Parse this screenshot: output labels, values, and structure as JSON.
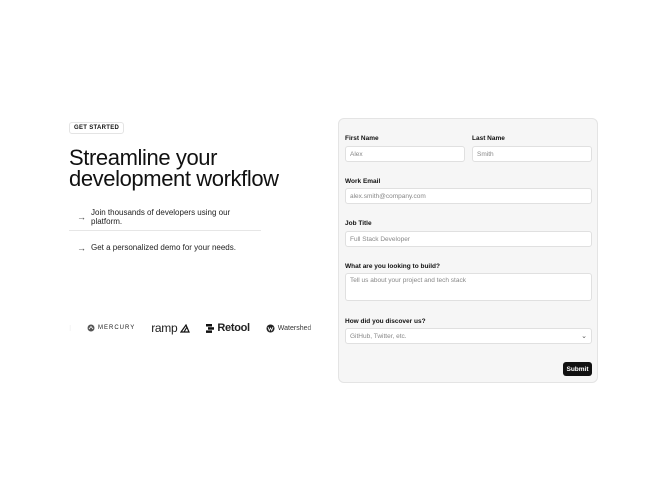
{
  "hero": {
    "badge": "GET STARTED",
    "title_line1": "Streamline your",
    "title_line2": "development workflow",
    "benefits": [
      {
        "icon": "arrow-right-icon",
        "text": "Join thousands of developers using our platform."
      },
      {
        "icon": "arrow-right-icon",
        "text": "Get a personalized demo for your needs."
      }
    ]
  },
  "logos": {
    "mercury": "MERCURY",
    "ramp": "ramp",
    "retool": "Retool",
    "watershed": "Watershed"
  },
  "form": {
    "first_name": {
      "label": "First Name",
      "placeholder": "Alex"
    },
    "last_name": {
      "label": "Last Name",
      "placeholder": "Smith"
    },
    "work_email": {
      "label": "Work Email",
      "placeholder": "alex.smith@company.com"
    },
    "job_title": {
      "label": "Job Title",
      "placeholder": "Full Stack Developer"
    },
    "build": {
      "label": "What are you looking to build?",
      "placeholder": "Tell us about your project and tech stack"
    },
    "discover": {
      "label": "How did you discover us?",
      "placeholder": "GitHub, Twitter, etc."
    },
    "submit_label": "Submit"
  }
}
